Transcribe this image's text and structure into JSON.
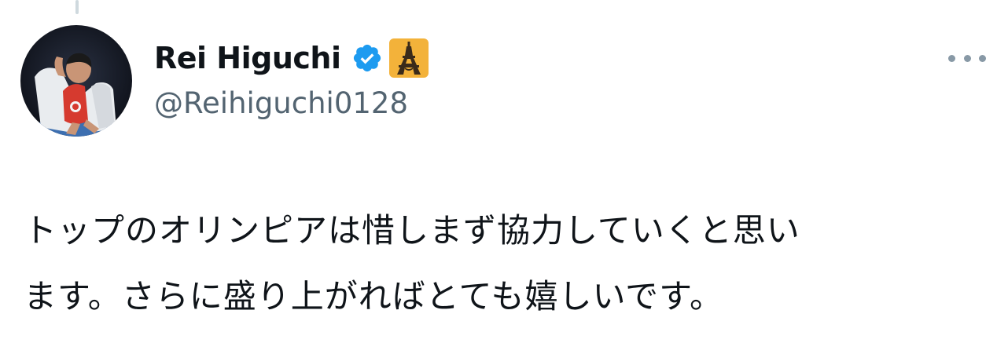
{
  "author": {
    "display_name": "Rei Higuchi",
    "handle": "@Reihiguchi0128",
    "verified_icon": "verified-badge-icon",
    "badge_icon": "eiffel-tower-icon",
    "colors": {
      "verified": "#1d9bf0",
      "badge_background": "#f3b23a",
      "name": "#0f1419",
      "handle": "#536471"
    }
  },
  "tweet": {
    "text_lines": [
      "トップのオリンピアは惜しまず協力していくと思い",
      "ます。さらに盛り上がればとても嬉しいです。"
    ]
  },
  "more_icon": "more-options-icon"
}
